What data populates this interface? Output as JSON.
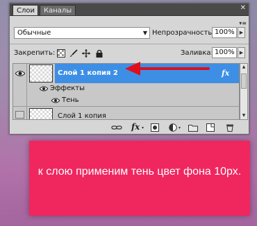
{
  "tabs": [
    {
      "label": "Слои"
    },
    {
      "label": "Каналы"
    }
  ],
  "blend_mode": "Обычные",
  "opacity": {
    "label": "Непрозрачность:",
    "value": "100%"
  },
  "lock": {
    "label": "Закрепить:"
  },
  "fill": {
    "label": "Заливка:",
    "value": "100%"
  },
  "layers": [
    {
      "name": "Слой 1 копия 2",
      "selected": true,
      "fx": "fx"
    },
    {
      "name": "Эффекты"
    },
    {
      "name": "Тень"
    },
    {
      "name": "Слой 1 копия"
    }
  ],
  "annotation": {
    "text": "к слою применим тень цвет фона 10рх."
  },
  "colors": {
    "banner": "#f0265f",
    "selection": "#3d8fe6",
    "arrow": "#e0101a",
    "panel": "#d6d6d6"
  },
  "icons": [
    "eye-icon",
    "chain-link-icon",
    "fx-icon",
    "layer-mask-icon",
    "adjustment-layer-icon",
    "group-folder-icon",
    "new-layer-icon",
    "trash-icon"
  ]
}
